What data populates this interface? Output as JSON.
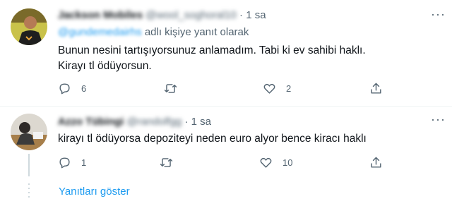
{
  "tweets": [
    {
      "display_name": "Jackson Mobiles",
      "handle": "@wool_soghoral10",
      "time": "1 sa",
      "reply_to_handle": "@gundemedairhs",
      "reply_to_suffix": "adlı kişiye yanıt olarak",
      "text": "Bunun nesini tartışıyorsunuz anlamadım. Tabi ki ev sahibi haklı. Kirayı tl ödüyorsun.",
      "replies": "6",
      "retweets": "",
      "likes": "2"
    },
    {
      "display_name": "Azzo Tübingi",
      "handle": "@randolfgg",
      "time": "1 sa",
      "text": "kirayı tl ödüyorsa depoziteyi neden euro alyor bence kiracı haklı",
      "replies": "1",
      "retweets": "",
      "likes": "10"
    }
  ],
  "separator": "·",
  "more_glyph": "···",
  "show_replies": "Yanıtları göster",
  "colors": {
    "accent": "#1d9bf0",
    "secondary": "#536471",
    "text": "#0f1419",
    "line": "#cfd9de"
  },
  "icons": [
    "reply-icon",
    "retweet-icon",
    "like-icon",
    "share-icon",
    "more-icon"
  ]
}
